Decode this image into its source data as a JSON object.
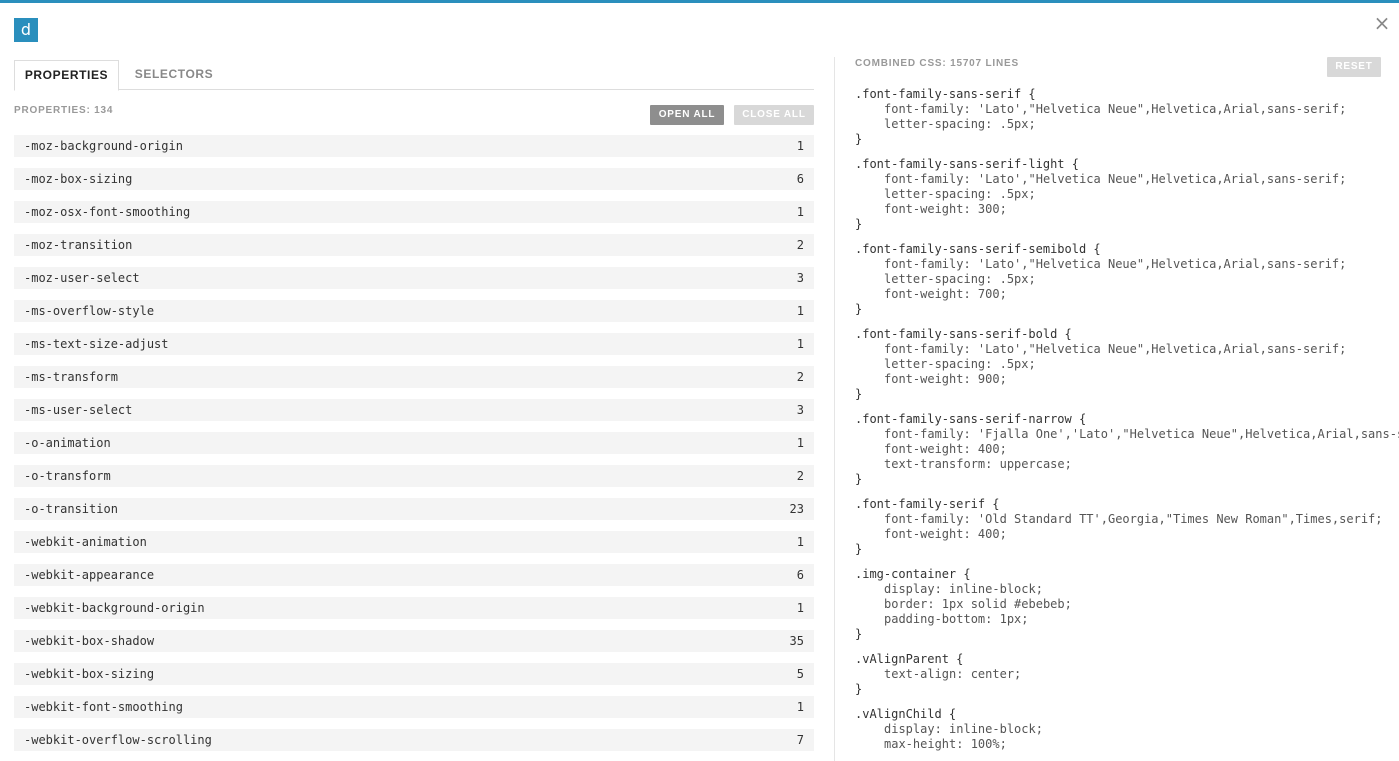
{
  "app": {
    "logo_letter": "d",
    "close_glyph": "×"
  },
  "tabs": [
    {
      "label": "PROPERTIES",
      "active": true
    },
    {
      "label": "SELECTORS",
      "active": false
    }
  ],
  "properties_header": "PROPERTIES: 134",
  "buttons": {
    "open_all": "OPEN ALL",
    "close_all": "CLOSE ALL",
    "reset": "RESET"
  },
  "properties": [
    {
      "name": "-moz-background-origin",
      "count": "1"
    },
    {
      "name": "-moz-box-sizing",
      "count": "6"
    },
    {
      "name": "-moz-osx-font-smoothing",
      "count": "1"
    },
    {
      "name": "-moz-transition",
      "count": "2"
    },
    {
      "name": "-moz-user-select",
      "count": "3"
    },
    {
      "name": "-ms-overflow-style",
      "count": "1"
    },
    {
      "name": "-ms-text-size-adjust",
      "count": "1"
    },
    {
      "name": "-ms-transform",
      "count": "2"
    },
    {
      "name": "-ms-user-select",
      "count": "3"
    },
    {
      "name": "-o-animation",
      "count": "1"
    },
    {
      "name": "-o-transform",
      "count": "2"
    },
    {
      "name": "-o-transition",
      "count": "23"
    },
    {
      "name": "-webkit-animation",
      "count": "1"
    },
    {
      "name": "-webkit-appearance",
      "count": "6"
    },
    {
      "name": "-webkit-background-origin",
      "count": "1"
    },
    {
      "name": "-webkit-box-shadow",
      "count": "35"
    },
    {
      "name": "-webkit-box-sizing",
      "count": "5"
    },
    {
      "name": "-webkit-font-smoothing",
      "count": "1"
    },
    {
      "name": "-webkit-overflow-scrolling",
      "count": "7"
    }
  ],
  "combined_header": "COMBINED CSS: 15707 LINES",
  "css_rules": [
    {
      "selector": ".font-family-sans-serif {",
      "decls": [
        "font-family: 'Lato',\"Helvetica Neue\",Helvetica,Arial,sans-serif;",
        "letter-spacing: .5px;"
      ]
    },
    {
      "selector": ".font-family-sans-serif-light {",
      "decls": [
        "font-family: 'Lato',\"Helvetica Neue\",Helvetica,Arial,sans-serif;",
        "letter-spacing: .5px;",
        "font-weight: 300;"
      ]
    },
    {
      "selector": ".font-family-sans-serif-semibold {",
      "decls": [
        "font-family: 'Lato',\"Helvetica Neue\",Helvetica,Arial,sans-serif;",
        "letter-spacing: .5px;",
        "font-weight: 700;"
      ]
    },
    {
      "selector": ".font-family-sans-serif-bold {",
      "decls": [
        "font-family: 'Lato',\"Helvetica Neue\",Helvetica,Arial,sans-serif;",
        "letter-spacing: .5px;",
        "font-weight: 900;"
      ]
    },
    {
      "selector": ".font-family-sans-serif-narrow {",
      "decls": [
        "font-family: 'Fjalla One','Lato',\"Helvetica Neue\",Helvetica,Arial,sans-serif;",
        "font-weight: 400;",
        "text-transform: uppercase;"
      ]
    },
    {
      "selector": ".font-family-serif {",
      "decls": [
        "font-family: 'Old Standard TT',Georgia,\"Times New Roman\",Times,serif;",
        "font-weight: 400;"
      ]
    },
    {
      "selector": ".img-container {",
      "decls": [
        "display: inline-block;",
        "border: 1px solid #ebebeb;",
        "padding-bottom: 1px;"
      ]
    },
    {
      "selector": ".vAlignParent {",
      "decls": [
        "text-align: center;"
      ]
    },
    {
      "selector": ".vAlignChild {",
      "decls": [
        "display: inline-block;",
        "max-height: 100%;"
      ]
    }
  ],
  "closing_brace": "}",
  "colors": {
    "accent": "#2a8fbd",
    "row_bg": "#f4f4f4",
    "button_dark": "#8e8e8e",
    "button_light": "#d8d8d8"
  }
}
